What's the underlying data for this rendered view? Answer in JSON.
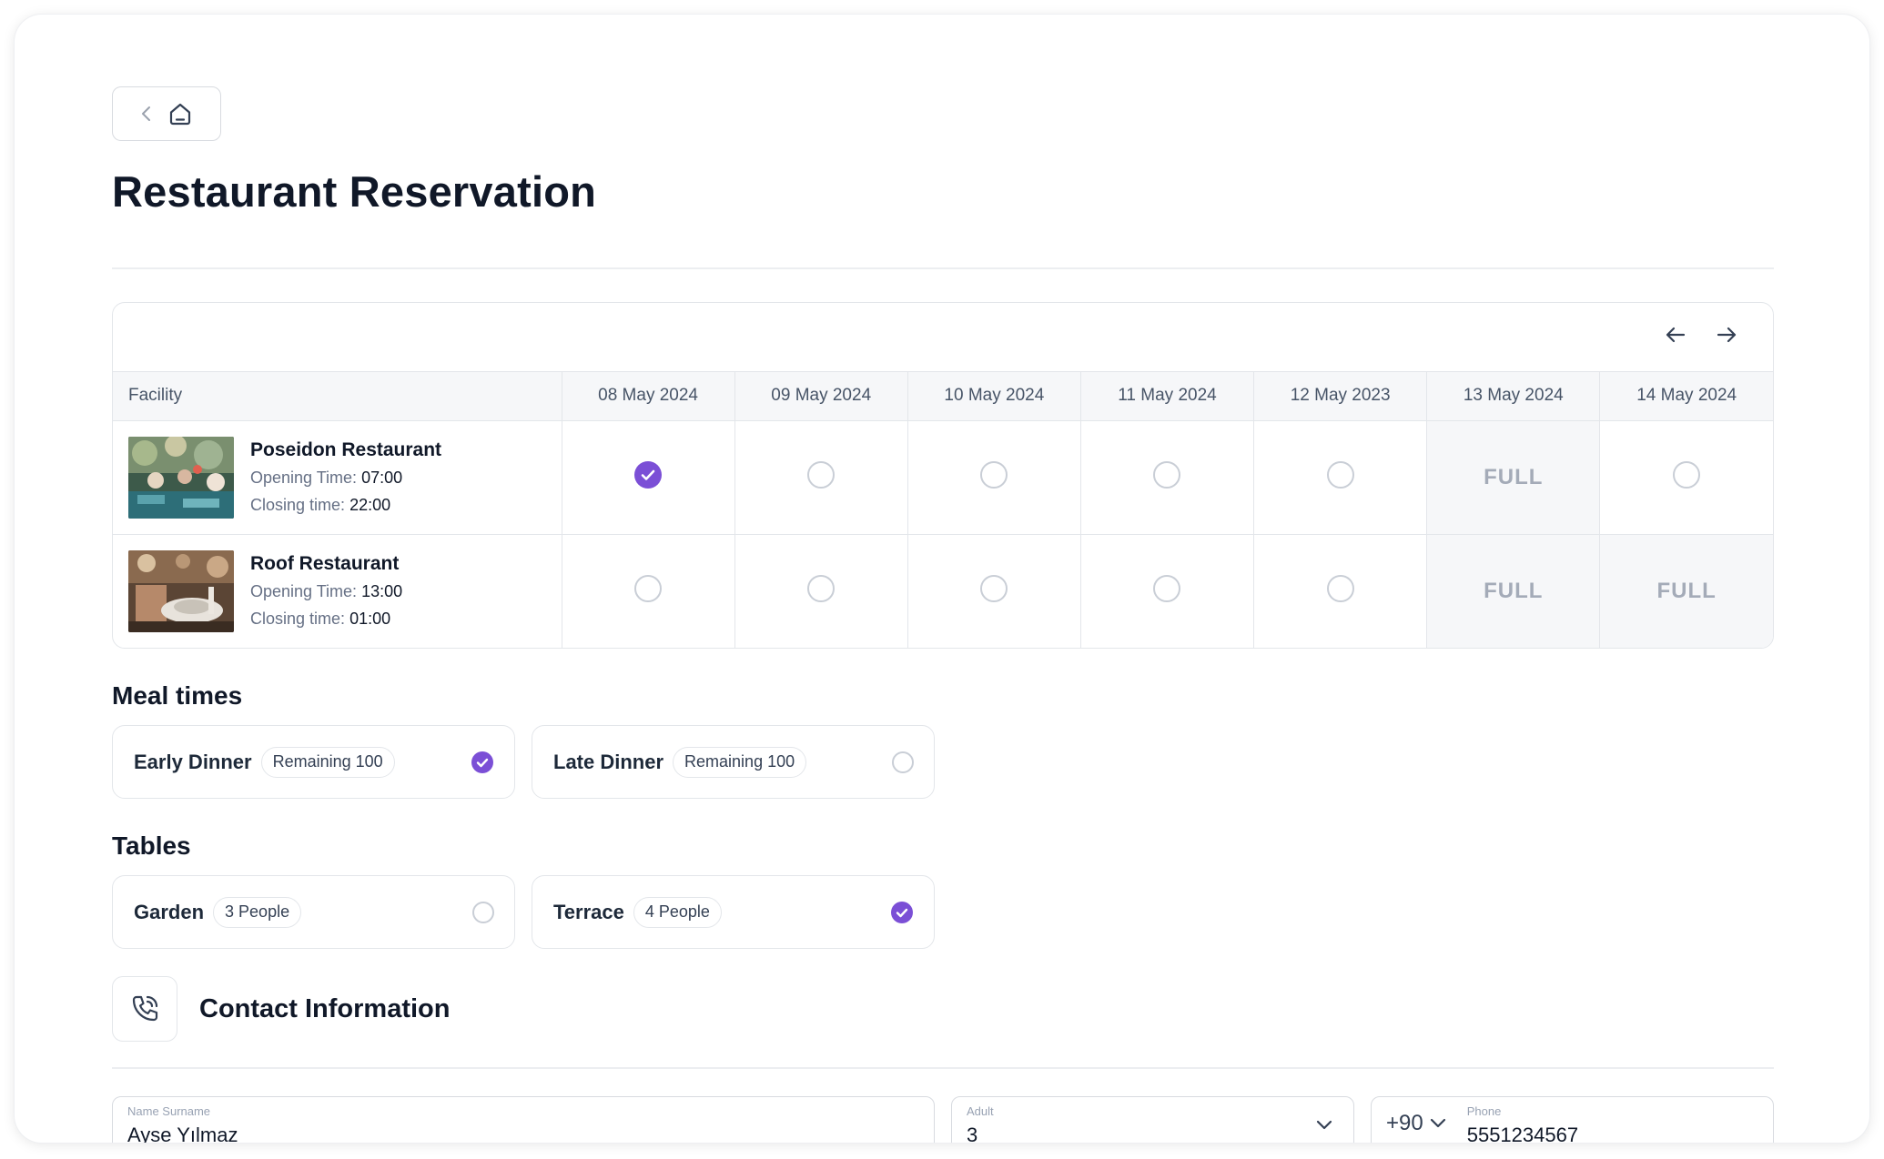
{
  "page": {
    "title": "Restaurant Reservation"
  },
  "colors": {
    "accent": "#7b4fd6",
    "full_text": "#a4abb8",
    "border": "#e3e6ea"
  },
  "calendar": {
    "facility_header": "Facility",
    "dates": [
      "08 May 2024",
      "09 May 2024",
      "10 May 2024",
      "11 May 2024",
      "12 May 2023",
      "13 May 2024",
      "14 May 2024"
    ],
    "facilities": [
      {
        "name": "Poseidon Restaurant",
        "opening_label": "Opening Time:",
        "opening_value": "07:00",
        "closing_label": "Closing time:",
        "closing_value": "22:00",
        "cells": [
          "selected",
          "open",
          "open",
          "open",
          "open",
          "FULL",
          "open"
        ]
      },
      {
        "name": "Roof Restaurant",
        "opening_label": "Opening Time:",
        "opening_value": "13:00",
        "closing_label": "Closing time:",
        "closing_value": "01:00",
        "cells": [
          "open",
          "open",
          "open",
          "open",
          "open",
          "FULL",
          "FULL"
        ]
      }
    ]
  },
  "meal_times": {
    "title": "Meal times",
    "options": [
      {
        "label": "Early Dinner",
        "badge": "Remaining 100",
        "selected": true
      },
      {
        "label": "Late Dinner",
        "badge": "Remaining 100",
        "selected": false
      }
    ]
  },
  "tables": {
    "title": "Tables",
    "options": [
      {
        "label": "Garden",
        "badge": "3 People",
        "selected": false
      },
      {
        "label": "Terrace",
        "badge": "4 People",
        "selected": true
      }
    ]
  },
  "contact": {
    "title": "Contact Information",
    "name_label": "Name Surname",
    "name_value": "Ayse Yılmaz",
    "adult_label": "Adult",
    "adult_value": "3",
    "phone_prefix": "+90",
    "phone_label": "Phone",
    "phone_value": "5551234567"
  }
}
